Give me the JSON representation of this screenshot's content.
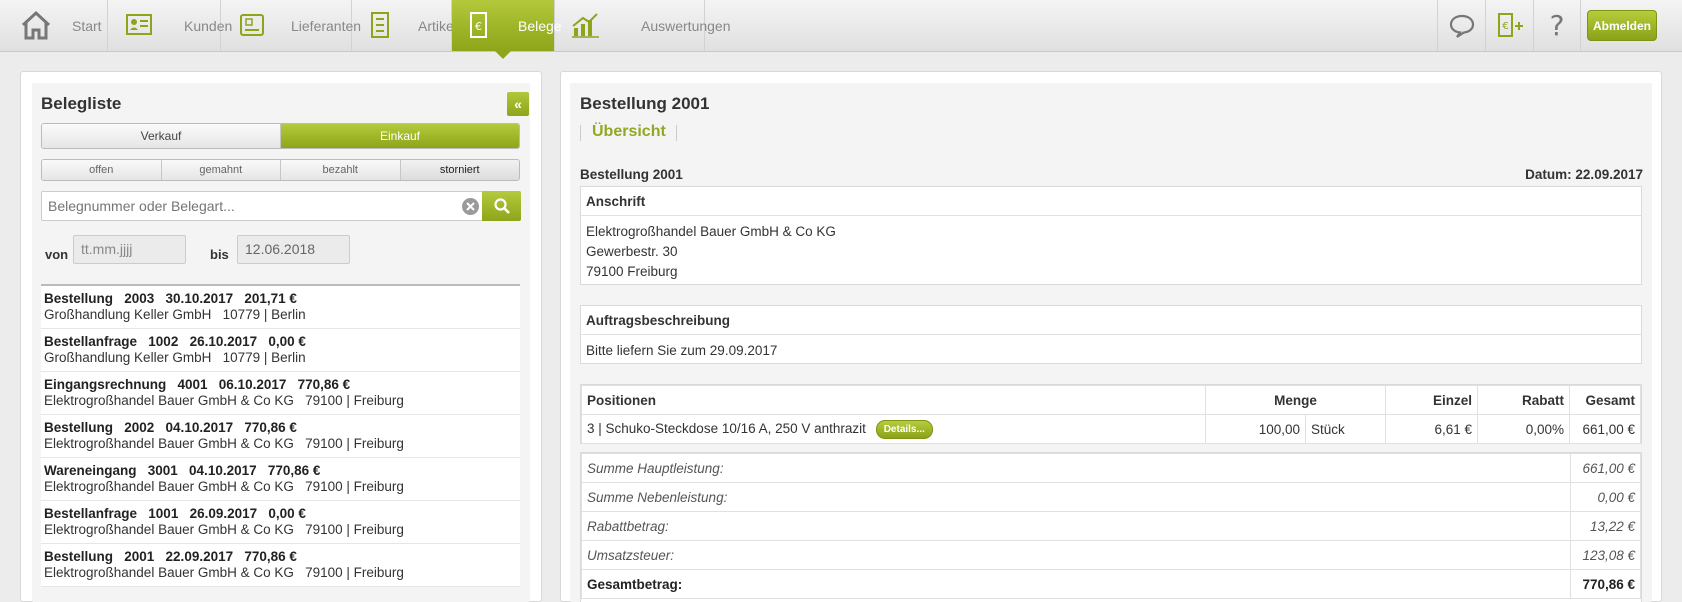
{
  "nav": {
    "items": [
      {
        "label": "Start",
        "icon": "home-icon"
      },
      {
        "label": "Kunden",
        "icon": "customer-card-icon"
      },
      {
        "label": "Lieferanten",
        "icon": "supplier-icon"
      },
      {
        "label": "Artikel",
        "icon": "article-icon"
      },
      {
        "label": "Belege",
        "icon": "document-icon",
        "active": true
      },
      {
        "label": "Auswertungen",
        "icon": "chart-icon"
      }
    ],
    "logout": "Abmelden",
    "help_glyph": "?"
  },
  "colors": {
    "accent": "#9cb22a",
    "accent_dark": "#8ea51a"
  },
  "left": {
    "title": "Belegliste",
    "collapse": "«",
    "type_tabs": [
      "Verkauf",
      "Einkauf"
    ],
    "type_active": "Einkauf",
    "status_tabs": [
      "offen",
      "gemahnt",
      "bezahlt",
      "storniert"
    ],
    "status_active": "storniert",
    "search_placeholder": "Belegnummer oder Belegart...",
    "von_label": "von",
    "von_placeholder": "tt.mm.jjjj",
    "bis_label": "bis",
    "bis_value": "12.06.2018",
    "list": [
      {
        "line1": "Bestellung   2003   30.10.2017   201,71 €",
        "line2": "Großhandlung Keller GmbH   10779 | Berlin"
      },
      {
        "line1": "Bestellanfrage   1002   26.10.2017   0,00 €",
        "line2": "Großhandlung Keller GmbH   10779 | Berlin"
      },
      {
        "line1": "Eingangsrechnung   4001   06.10.2017   770,86 €",
        "line2": "Elektrogroßhandel Bauer GmbH & Co KG   79100 | Freiburg"
      },
      {
        "line1": "Bestellung   2002   04.10.2017   770,86 €",
        "line2": "Elektrogroßhandel Bauer GmbH & Co KG   79100 | Freiburg"
      },
      {
        "line1": "Wareneingang   3001   04.10.2017   770,86 €",
        "line2": "Elektrogroßhandel Bauer GmbH & Co KG   79100 | Freiburg"
      },
      {
        "line1": "Bestellanfrage   1001   26.09.2017   0,00 €",
        "line2": "Elektrogroßhandel Bauer GmbH & Co KG   79100 | Freiburg"
      },
      {
        "line1": "Bestellung   2001   22.09.2017   770,86 €",
        "line2": "Elektrogroßhandel Bauer GmbH & Co KG   79100 | Freiburg"
      }
    ]
  },
  "right": {
    "title": "Bestellung 2001",
    "tab": "Übersicht",
    "doc_label": "Bestellung 2001",
    "date": "Datum: 22.09.2017",
    "address": {
      "head": "Anschrift",
      "lines": [
        "Elektrogroßhandel Bauer GmbH & Co KG",
        "Gewerbestr. 30",
        "79100 Freiburg"
      ]
    },
    "description": {
      "head": "Auftragsbeschreibung",
      "text": "Bitte liefern Sie zum 29.09.2017"
    },
    "positions": {
      "headers": [
        "Positionen",
        "Menge",
        "Einzel",
        "Rabatt",
        "Gesamt"
      ],
      "rows": [
        {
          "name": "3 | Schuko-Steckdose 10/16 A, 250 V anthrazit",
          "details": "Details...",
          "qty": "100,00",
          "unit": "Stück",
          "single": "6,61 €",
          "discount": "0,00%",
          "total": "661,00 €"
        }
      ]
    },
    "summary": [
      {
        "label": "Summe Hauptleistung:",
        "value": "661,00 €"
      },
      {
        "label": "Summe Nebenleistung:",
        "value": "0,00 €"
      },
      {
        "label": "Rabattbetrag:",
        "value": "13,22 €"
      },
      {
        "label": "Umsatzsteuer:",
        "value": "123,08 €"
      },
      {
        "label": "Gesamtbetrag:",
        "value": "770,86 €",
        "total": true
      }
    ]
  }
}
